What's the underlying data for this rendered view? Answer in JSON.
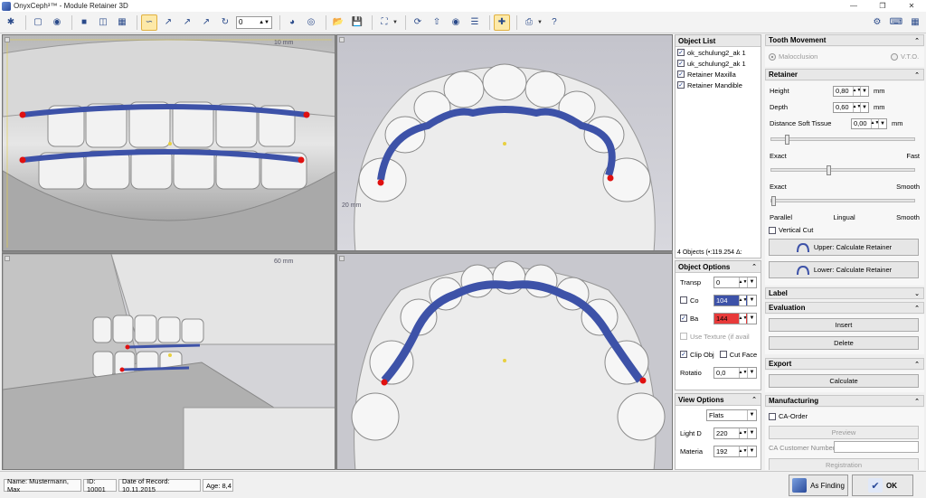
{
  "window": {
    "title": "OnyxCeph³™ - Module Retainer 3D",
    "controls": [
      "minimize",
      "restore",
      "close"
    ]
  },
  "toolbar": {
    "spin_value": "0",
    "icons": [
      "star-icon",
      "cube-icon",
      "eye-icon",
      "layout-single-icon",
      "layout-split-icon",
      "layout-grid-icon",
      "retainer-path-icon",
      "axis-x-icon",
      "axis-y-icon",
      "axis-z-icon",
      "rotate-icon",
      "jaw-icon",
      "jaw-both-icon",
      "open-icon",
      "save-icon",
      "crop-icon",
      "rotate-view-icon",
      "export-icon",
      "tooth-icon",
      "notes-icon",
      "add-point-icon",
      "print-icon",
      "help-icon"
    ],
    "right_icons": [
      "settings-icon",
      "keyboard-icon",
      "grid-icon"
    ]
  },
  "viewports": {
    "top_left_ruler": "10 mm",
    "bottom_left_ruler": "60 mm",
    "top_right_ruler": "20 mm",
    "colors": {
      "retainer": "#3d52a8",
      "endpoint": "#e01010",
      "model": "#e6e6e6",
      "background": "#c9c9cf"
    }
  },
  "object_list": {
    "title": "Object List",
    "items": [
      {
        "label": "ok_schulung2_ak 1",
        "checked": true
      },
      {
        "label": "uk_schulung2_ak 1",
        "checked": true
      },
      {
        "label": "Retainer Maxilla",
        "checked": true
      },
      {
        "label": "Retainer Mandible",
        "checked": true
      }
    ],
    "status": "4 Objects (•:119.254 Δ:"
  },
  "object_options": {
    "title": "Object Options",
    "transparency_label": "Transp",
    "transparency_value": "0",
    "color_label": "Co",
    "color_value": "104",
    "color_checked": false,
    "color_swatch": "#3d52a8",
    "back_label": "Ba",
    "back_value": "144",
    "back_checked": true,
    "back_swatch": "#e83a3a",
    "use_texture": "Use Texture  (if avail",
    "clip_objects": "Clip Obj",
    "clip_checked": true,
    "cut_faces": "Cut Face",
    "cut_checked": false,
    "rotation_label": "Rotatio",
    "rotation_value": "0,0"
  },
  "view_options": {
    "title": "View Options",
    "shading": "Flats",
    "light_label": "Light D",
    "light_value": "220",
    "material_label": "Materia",
    "material_value": "192"
  },
  "tooth_movement": {
    "title": "Tooth Movement",
    "malocclusion": "Malocclusion",
    "vto": "V.T.O."
  },
  "retainer": {
    "title": "Retainer",
    "height_label": "Height",
    "height_value": "0,80",
    "depth_label": "Depth",
    "depth_value": "0,60",
    "dist_label": "Distance Soft Tissue",
    "dist_value": "0,00",
    "unit": "mm",
    "slider1": {
      "left": "Exact",
      "right": "Fast",
      "value": 0.1
    },
    "slider2": {
      "left": "Exact",
      "right": "Smooth",
      "value": 0.4
    },
    "slider3": {
      "left": "Parallel",
      "mid": "Lingual",
      "right": "Smooth",
      "value": 0.0
    },
    "vertical_cut": "Vertical Cut",
    "upper_button": "Upper: Calculate Retainer",
    "lower_button": "Lower: Calculate Retainer"
  },
  "label_section": {
    "title": "Label"
  },
  "evaluation": {
    "title": "Evaluation",
    "insert": "Insert",
    "delete": "Delete"
  },
  "export": {
    "title": "Export",
    "calculate": "Calculate"
  },
  "manufacturing": {
    "title": "Manufacturing",
    "ca_order": "CA-Order",
    "preview": "Preview",
    "customer_label": "CA Customer Number",
    "customer_value": "",
    "registration": "Registration"
  },
  "status": {
    "name": "Name: Mustermann, Max",
    "id": "ID: 10001",
    "date": "Date of Record: 10.11.2015",
    "age": "Age: 8,4",
    "as_finding": "As Finding",
    "ok": "OK"
  }
}
